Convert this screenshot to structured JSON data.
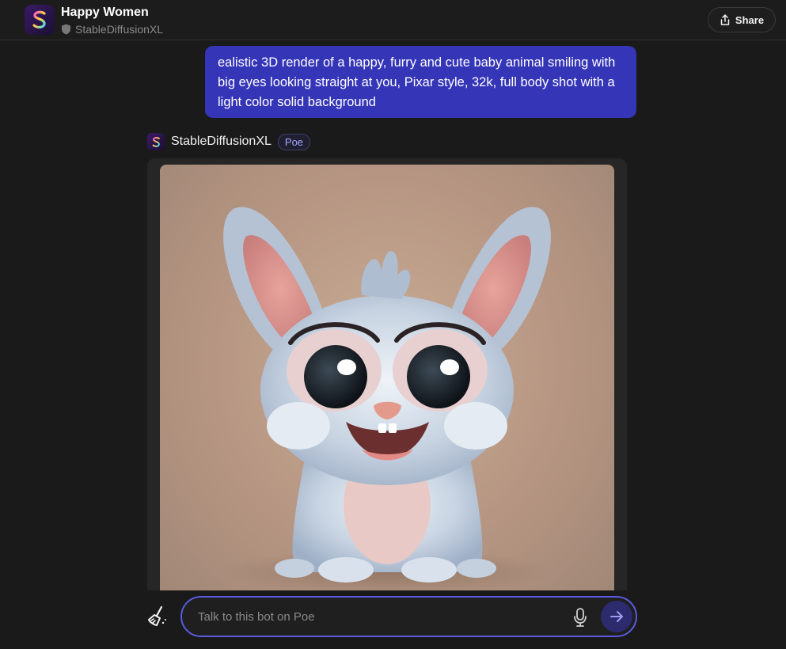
{
  "header": {
    "title": "Happy Women",
    "subtitle": "StableDiffusionXL",
    "share_label": "Share",
    "avatar_icon": "stablediffusion-s-logo",
    "subtitle_icon": "shield-icon"
  },
  "conversation": {
    "user_message": "ealistic 3D render of a happy, furry and cute baby animal smiling with big eyes looking straight at you, Pixar style, 32k, full body shot with a light color solid background",
    "bot_name": "StableDiffusionXL",
    "bot_badge": "Poe",
    "bot_response_type": "generated-image"
  },
  "composer": {
    "placeholder": "Talk to this bot on Poe",
    "value": "",
    "clear_icon": "broom-icon",
    "mic_icon": "microphone-icon",
    "send_icon": "arrow-right-icon"
  },
  "colors": {
    "background": "#1a1a1a",
    "user_bubble": "#3535b8",
    "accent_border": "#5b5be0",
    "badge_text": "#a7a6ff"
  }
}
